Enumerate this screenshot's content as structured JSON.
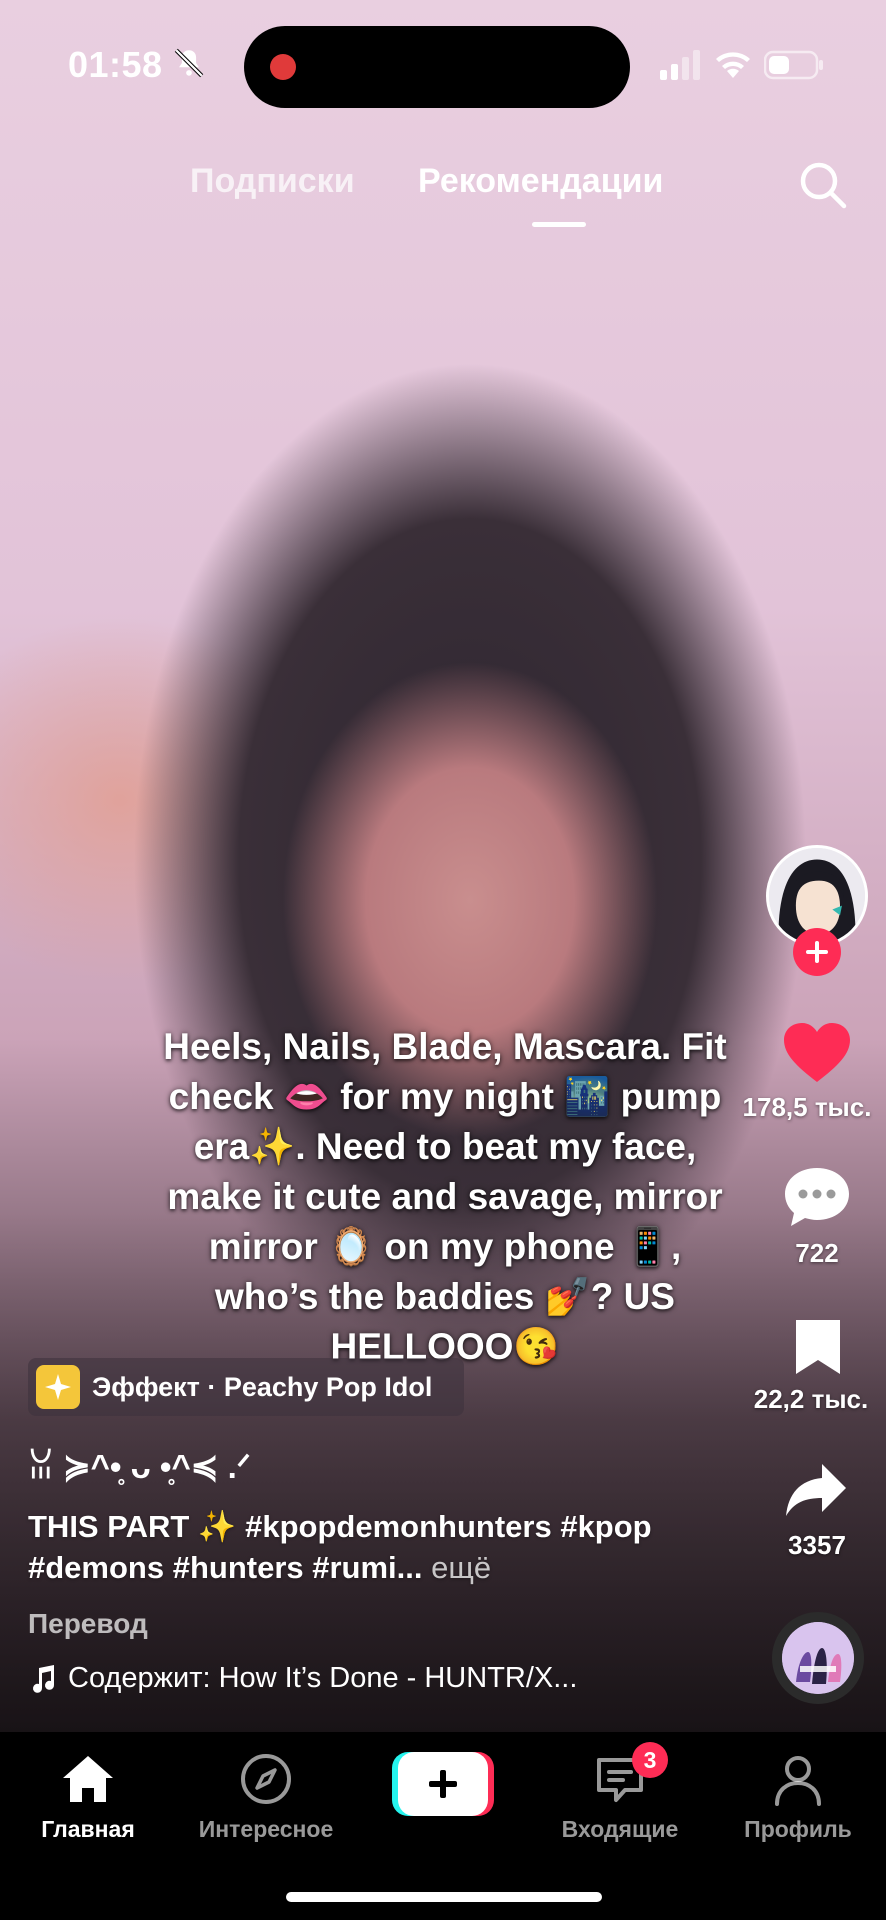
{
  "status_bar": {
    "time": "01:58",
    "icons": [
      "bell-muted-icon",
      "cellular-signal-icon",
      "wifi-icon",
      "battery-icon"
    ],
    "recording_indicator_color": "#e03a3a"
  },
  "top_tabs": {
    "following": "Подписки",
    "for_you": "Рекомендации",
    "active": "for_you"
  },
  "overlay_caption": "Heels, Nails, Blade, Mascara. Fit check 👄 for my night 🌃 pump era✨. Need to beat my face, make it cute and savage, mirror mirror 🪞 on my phone 📱, who’s the baddies 💅? US HELLOOO😘",
  "actions": {
    "likes": "178,5 тыс.",
    "comments": "722",
    "saves": "22,2 тыс.",
    "shares": "3357",
    "like_color": "#fe2c55"
  },
  "effect": {
    "label": "Эффект · Peachy Pop Idol"
  },
  "post": {
    "username": "ꈍ ≽^•̥ ᴗ •̥^≼ .ᐟ",
    "description": "THIS PART ✨ #kpopdemonhunters #kpop #demons #hunters #rumi...",
    "more": "ещё",
    "translate": "Перевод",
    "music": "Содержит: How It’s Done - HUNTR/X..."
  },
  "bottom_nav": {
    "home": "Главная",
    "discover": "Интересное",
    "inbox": "Входящие",
    "inbox_badge": "3",
    "profile": "Профиль",
    "active": "home"
  },
  "colors": {
    "accent": "#fe2c55",
    "create_left": "#25f4ee",
    "create_right": "#fe2c55"
  }
}
